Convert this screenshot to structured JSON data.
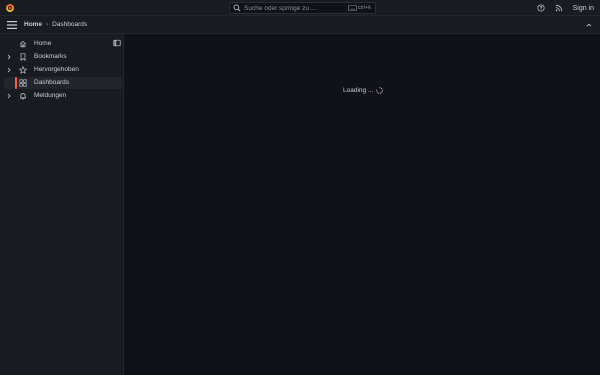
{
  "app": {
    "logo_icon": "grafana-logo-icon"
  },
  "search": {
    "placeholder": "Suche oder springe zu ...",
    "shortcut": "ctrl+k"
  },
  "top_right": {
    "help_icon": "help-icon",
    "rss_icon": "rss-icon",
    "signin_label": "Sign in"
  },
  "breadcrumb": {
    "home": "Home",
    "current": "Dashboards"
  },
  "sidebar": {
    "items": [
      {
        "label": "Home",
        "icon": "home-icon",
        "expandable": false
      },
      {
        "label": "Bookmarks",
        "icon": "bookmark-icon",
        "expandable": true
      },
      {
        "label": "Hervorgehoben",
        "icon": "star-icon",
        "expandable": true
      },
      {
        "label": "Dashboards",
        "icon": "apps-icon",
        "expandable": false,
        "active": true
      },
      {
        "label": "Meldungen",
        "icon": "bell-icon",
        "expandable": true
      }
    ]
  },
  "main": {
    "loading_text": "Loading ..."
  },
  "colors": {
    "accent": "#f55f3e",
    "background": "#111217",
    "panel": "#181b1f"
  }
}
